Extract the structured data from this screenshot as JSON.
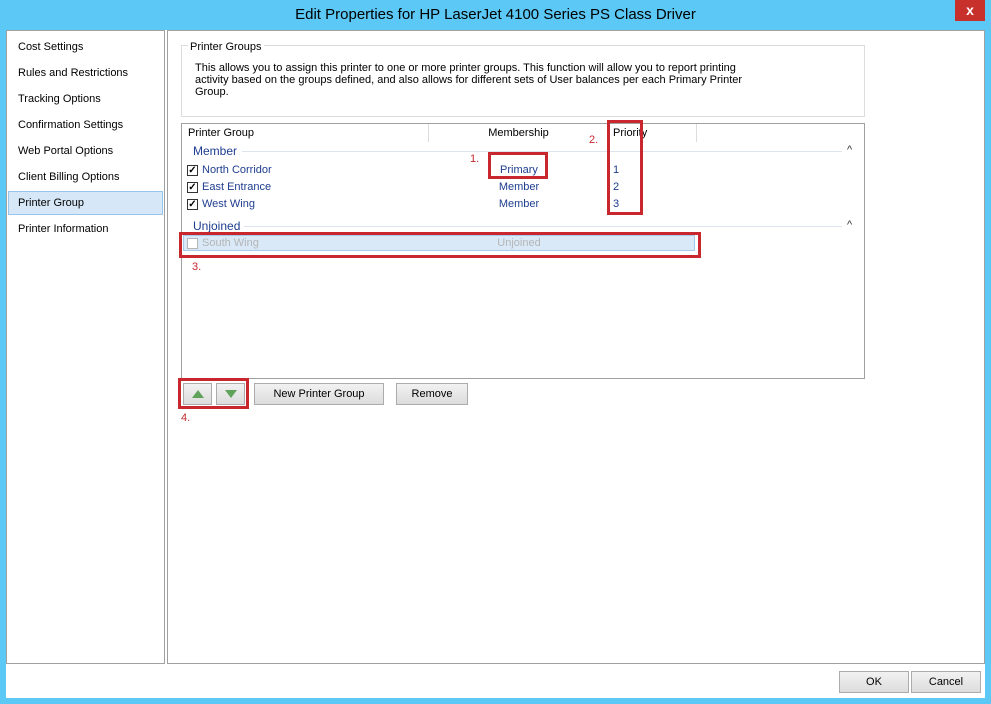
{
  "window": {
    "title": "Edit Properties for HP LaserJet 4100 Series PS Class Driver",
    "close_glyph": "x"
  },
  "sidebar": {
    "items": [
      {
        "label": "Cost Settings"
      },
      {
        "label": "Rules and Restrictions"
      },
      {
        "label": "Tracking Options"
      },
      {
        "label": "Confirmation Settings"
      },
      {
        "label": "Web Portal Options"
      },
      {
        "label": "Client Billing Options"
      },
      {
        "label": "Printer Group"
      },
      {
        "label": "Printer Information"
      }
    ],
    "active_index": 6
  },
  "printer_groups": {
    "section_label": "Printer Groups",
    "description": "This allows you to assign this printer to one or more printer groups. This function will allow you to report printing activity based on the groups defined, and also allows for different sets of User balances per each Primary Printer Group."
  },
  "list": {
    "columns": [
      "Printer Group",
      "Membership",
      "Priority"
    ],
    "groups": [
      {
        "title": "Member",
        "rows": [
          {
            "name": "North Corridor",
            "membership": "Primary",
            "priority": "1",
            "checked": true
          },
          {
            "name": "East Entrance",
            "membership": "Member",
            "priority": "2",
            "checked": true
          },
          {
            "name": "West Wing",
            "membership": "Member",
            "priority": "3",
            "checked": true
          }
        ]
      },
      {
        "title": "Unjoined",
        "rows": [
          {
            "name": "South Wing",
            "membership": "Unjoined",
            "priority": "",
            "checked": false
          }
        ]
      }
    ],
    "collapse_glyph": "^",
    "check_glyph": "✓"
  },
  "annotations": [
    "1.",
    "2.",
    "3.",
    "4."
  ],
  "toolbar": {
    "new_group_label": "New Printer Group",
    "remove_label": "Remove"
  },
  "footer": {
    "ok_label": "OK",
    "cancel_label": "Cancel"
  },
  "colors": {
    "title_bar": "#5bc8f5",
    "close_button": "#c7302b",
    "annotation_red": "#c8282d",
    "link_blue": "#1e3d8f",
    "arrow_green": "#5fa35a"
  }
}
